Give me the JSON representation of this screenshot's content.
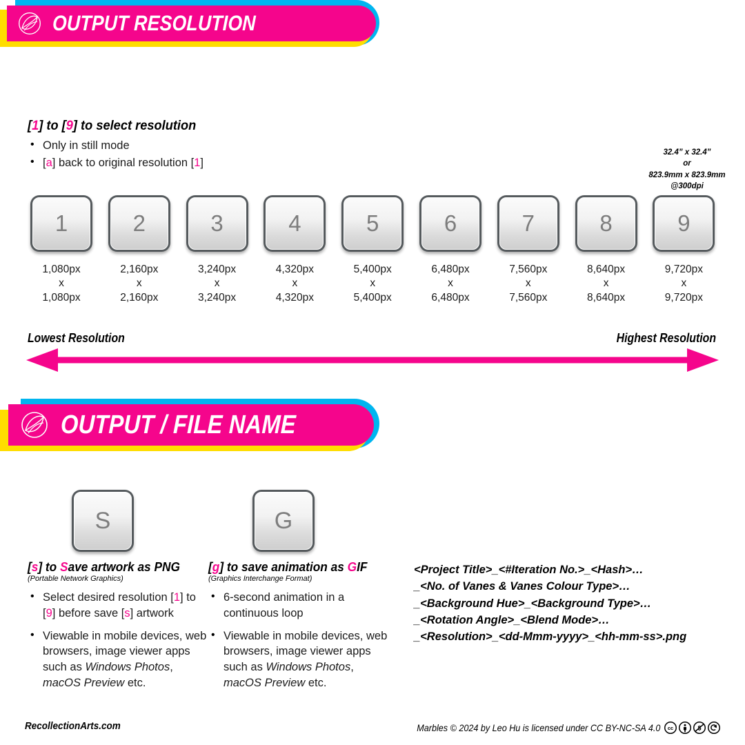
{
  "sections": {
    "resolution": {
      "banner_title": "OUTPUT RESOLUTION",
      "logo_icon": "leaf-circle-logo-icon",
      "headline_parts": {
        "b1": "[",
        "k1": "1",
        "b2": "] to [",
        "k2": "9",
        "b3": "] to select resolution"
      },
      "bullets": [
        "Only in still mode",
        "[a] back to original resolution [1]"
      ],
      "bullet2_parts": {
        "pre": "[",
        "key": "a",
        "mid": "] back to original resolution [",
        "key2": "1",
        "post": "]"
      },
      "dpi_note": {
        "line1": "32.4” x 32.4”",
        "line2": "or",
        "line3": "823.9mm x 823.9mm",
        "line4": "@300dpi"
      },
      "keys": [
        {
          "cap": "1",
          "w": "1,080px",
          "x": "x",
          "h": "1,080px"
        },
        {
          "cap": "2",
          "w": "2,160px",
          "x": "x",
          "h": "2,160px"
        },
        {
          "cap": "3",
          "w": "3,240px",
          "x": "x",
          "h": "3,240px"
        },
        {
          "cap": "4",
          "w": "4,320px",
          "x": "x",
          "h": "4,320px"
        },
        {
          "cap": "5",
          "w": "5,400px",
          "x": "x",
          "h": "5,400px"
        },
        {
          "cap": "6",
          "w": "6,480px",
          "x": "x",
          "h": "6,480px"
        },
        {
          "cap": "7",
          "w": "7,560px",
          "x": "x",
          "h": "7,560px"
        },
        {
          "cap": "8",
          "w": "8,640px",
          "x": "x",
          "h": "8,640px"
        },
        {
          "cap": "9",
          "w": "9,720px",
          "x": "x",
          "h": "9,720px"
        }
      ],
      "scale_low": "Lowest Resolution",
      "scale_high": "Highest Resolution"
    },
    "filename": {
      "banner_title": "OUTPUT / FILE NAME",
      "logo_icon": "leaf-circle-logo-icon",
      "save_key": "S",
      "gif_key": "G",
      "png": {
        "headline_pre": "[",
        "headline_key": "s",
        "headline_mid": "] to ",
        "headline_s": "S",
        "headline_post": "ave artwork as PNG",
        "subnote": "(Portable Network Graphics)",
        "bullets_rich": [
          {
            "a": "Select desired resolution [",
            "k1": "1",
            "b": "] to [",
            "k2": "9",
            "c": "] before save [",
            "k3": "s",
            "d": "] artwork"
          }
        ],
        "bullet2": {
          "plain": "Viewable in mobile devices, web browsers, image viewer apps such as ",
          "it1": "Windows Photos",
          "mid": ", ",
          "it2": "macOS Preview",
          "tail": " etc."
        }
      },
      "gif": {
        "headline_pre": "[",
        "headline_key": "g",
        "headline_mid": "] to save animation as ",
        "headline_g": "G",
        "headline_post": "IF",
        "subnote": "(Graphics Interchange Format)",
        "bullet1": "6-second animation in a continuous loop",
        "bullet2": {
          "plain": "Viewable in mobile devices, web browsers, image viewer apps such as ",
          "it1": "Windows Photos",
          "mid": ", ",
          "it2": "macOS Preview",
          "tail": " etc."
        }
      },
      "pattern": [
        "<Project Title>_<#Iteration No.>_<Hash>…",
        "_<No. of Vanes & Vanes Colour Type>…",
        "_<Background Hue>_<Background Type>…",
        "_<Rotation Angle>_<Blend Mode>…",
        "_<Resolution>_<dd-Mmm-yyyy>_<hh-mm-ss>.png"
      ]
    }
  },
  "footer": {
    "site": "RecollectionArts.com",
    "license": "Marbles © 2024 by Leo Hu is licensed under CC BY-NC-SA 4.0",
    "badges": [
      "cc-icon",
      "by-icon",
      "nc-icon",
      "sa-icon"
    ]
  },
  "colors": {
    "magenta": "#f5058c",
    "cyan": "#00b5ef",
    "yellow": "#ffdd00",
    "text": "#000000"
  }
}
